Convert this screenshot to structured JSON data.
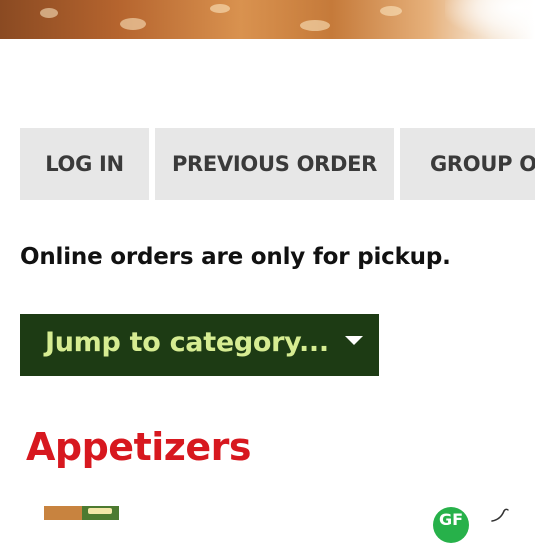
{
  "hero": {
    "alt": "fried food banner"
  },
  "nav": {
    "login": "LOG IN",
    "previous_order": "PREVIOUS ORDER",
    "group_order": "GROUP ORDER"
  },
  "notice": "Online orders are only for pickup.",
  "jump": {
    "label": "Jump to category..."
  },
  "section": {
    "title": "Appetizers"
  },
  "item": {
    "badge_text": "GF"
  },
  "colors": {
    "jump_bg": "#1d3b14",
    "jump_text": "#d6ec92",
    "section_title": "#d7181f",
    "tab_bg": "#e7e7e7",
    "badge_bg": "#27b14a"
  }
}
